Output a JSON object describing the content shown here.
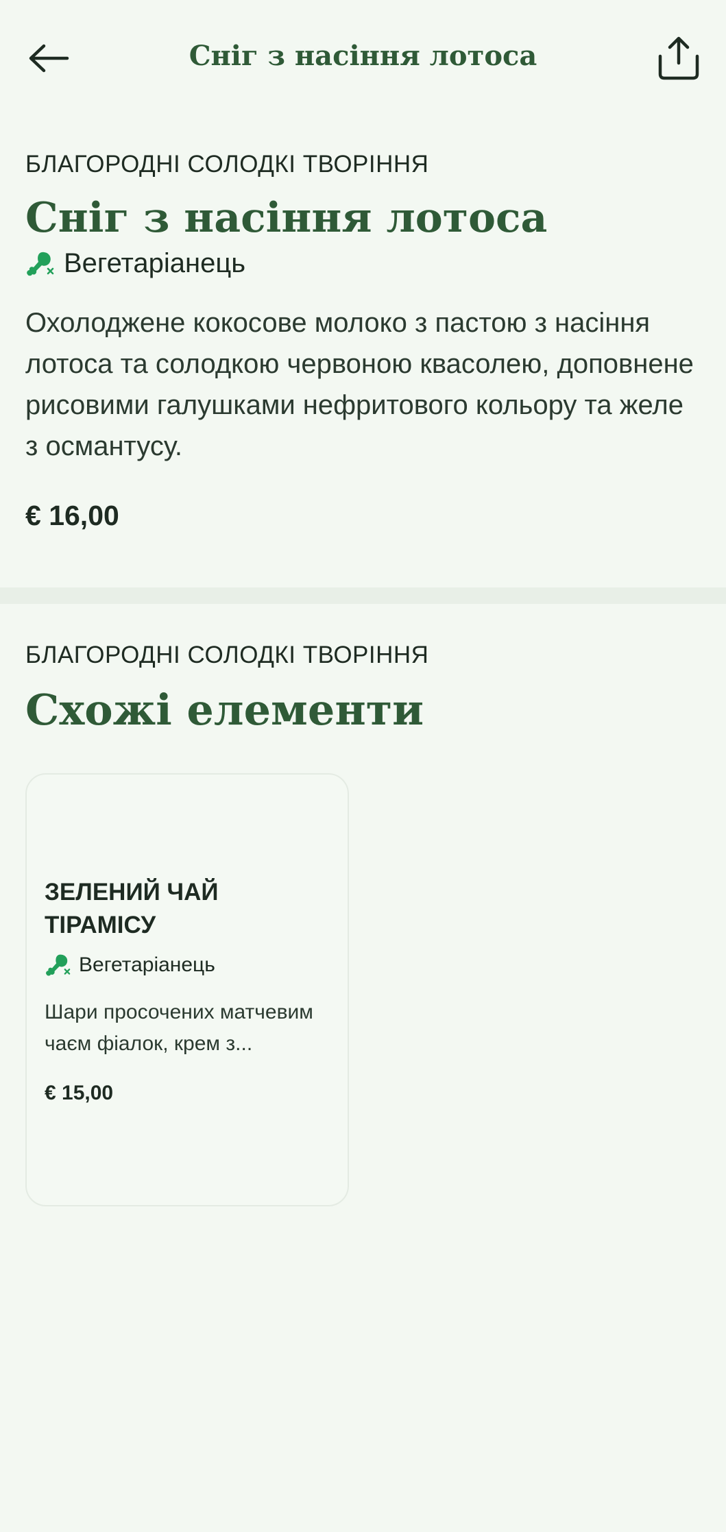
{
  "header": {
    "title": "Сніг з насіння лотоса",
    "back_icon": "arrow-left-icon",
    "share_icon": "share-icon"
  },
  "product": {
    "category": "БЛАГОРОДНІ СОЛОДКІ ТВОРІННЯ",
    "name": "Сніг з насіння лотоса",
    "diet_label": "Вегетаріанець",
    "diet_icon": "no-meat-icon",
    "description": "Охолоджене кокосове молоко з пастою з насіння лотоса та солодкою червоною квасолею, доповнене рисовими галушками нефритового кольору та желе з османтусу.",
    "price": "€ 16,00"
  },
  "similar": {
    "category": "БЛАГОРОДНІ СОЛОДКІ ТВОРІННЯ",
    "title": "Схожі елементи",
    "items": [
      {
        "name": "ЗЕЛЕНИЙ ЧАЙ ТІРАМІСУ",
        "diet_label": "Вегетаріанець",
        "description": "Шари просочених матчевим чаєм фіалок, крем з...",
        "price": "€ 15,00"
      }
    ]
  },
  "colors": {
    "background": "#f3f8f2",
    "heading_green": "#2f5a37",
    "diet_icon_green": "#22a05a",
    "text_dark": "#1e2b22",
    "divider": "#e8efe7"
  }
}
